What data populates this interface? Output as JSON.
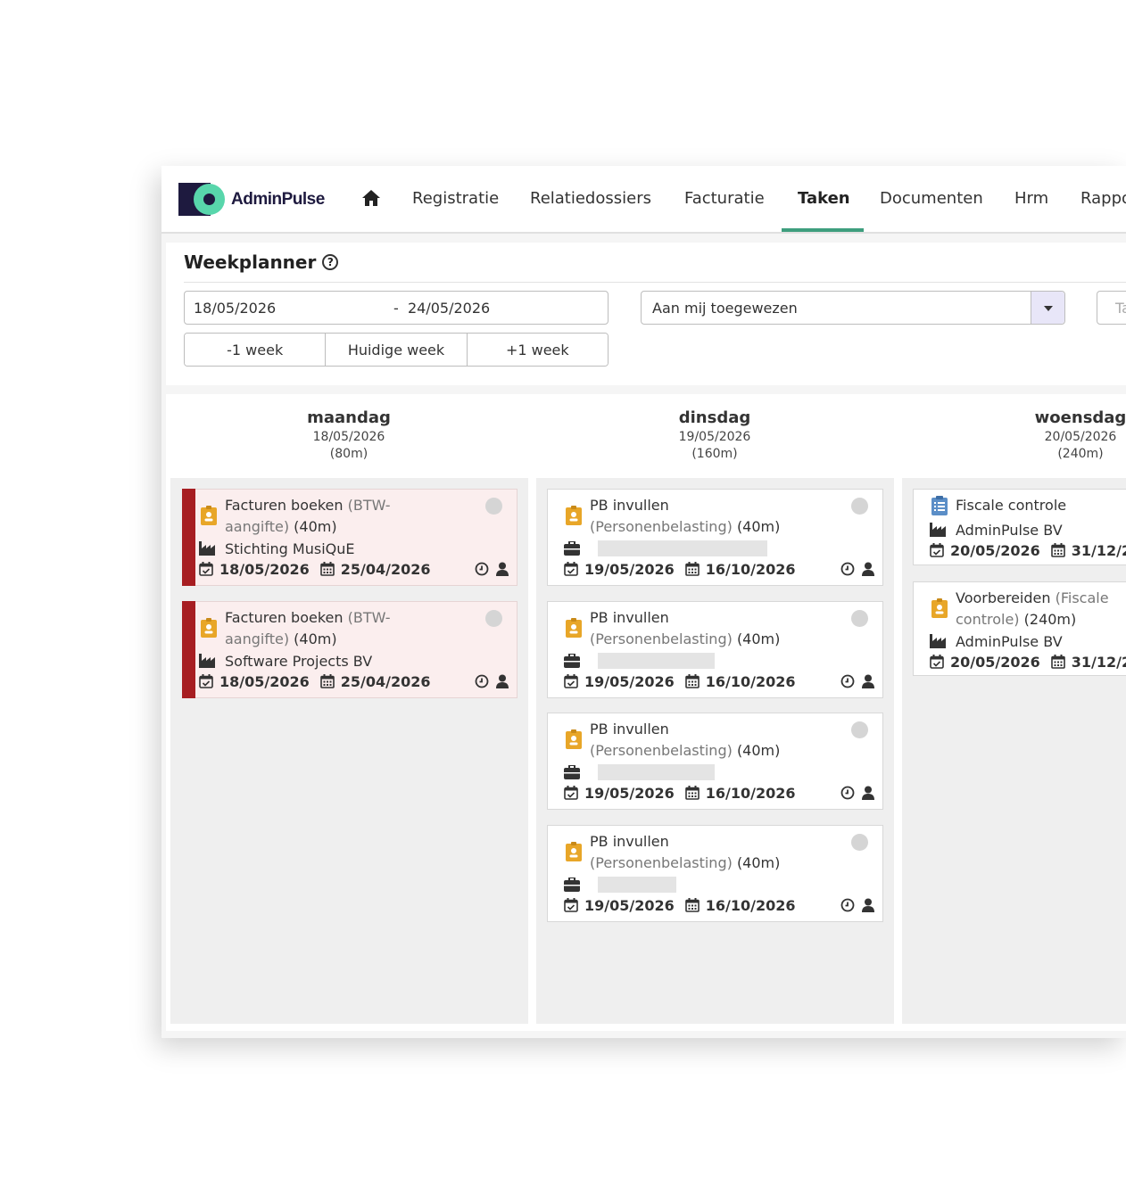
{
  "app": {
    "brand": "AdminPulse",
    "colors": {
      "brand_dark": "#1e1a3f",
      "brand_accent": "#58d6ab",
      "tab_underline": "#3e9e7e",
      "overdue": "#a71e22",
      "task_icon": "#e8a628",
      "clipboard_icon": "#5b8ec7"
    }
  },
  "nav": {
    "home_icon": "home-icon",
    "items": [
      {
        "label": "Registratie"
      },
      {
        "label": "Relatiedossiers"
      },
      {
        "label": "Facturatie"
      },
      {
        "label": "Taken",
        "active": true
      },
      {
        "label": "Documenten"
      },
      {
        "label": "Hrm"
      },
      {
        "label": "Rapportering"
      }
    ]
  },
  "planner": {
    "title": "Weekplanner",
    "help_icon": "question-circle-icon",
    "date_from": "18/05/2026",
    "date_separator": "-",
    "date_to": "24/05/2026",
    "week_buttons": [
      "-1 week",
      "Huidige week",
      "+1 week"
    ],
    "assignee_filter": "Aan mij toegewezen",
    "extra_filter_placeholder": "Taken"
  },
  "days": [
    {
      "name": "maandag",
      "date": "18/05/2026",
      "duration": "(80m)",
      "tasks": [
        {
          "type_icon": "id-badge-icon",
          "title": "Facturen boeken",
          "subtitle": "(BTW-aangifte)",
          "subtitle_line1": "(BTW-",
          "subtitle_line2": "aangifte)",
          "duration": "(40m)",
          "client_icon": "factory-icon",
          "client": "Stichting MusiQuE",
          "start": "18/05/2026",
          "due": "25/04/2026",
          "overdue": true
        },
        {
          "type_icon": "id-badge-icon",
          "title": "Facturen boeken",
          "subtitle": "(BTW-aangifte)",
          "subtitle_line1": "(BTW-",
          "subtitle_line2": "aangifte)",
          "duration": "(40m)",
          "client_icon": "factory-icon",
          "client": "Software Projects BV",
          "start": "18/05/2026",
          "due": "25/04/2026",
          "overdue": true
        }
      ]
    },
    {
      "name": "dinsdag",
      "date": "19/05/2026",
      "duration": "(160m)",
      "tasks": [
        {
          "type_icon": "id-badge-icon",
          "title": "PB invullen",
          "subtitle": "(Personenbelasting)",
          "duration": "(40m)",
          "client_icon": "briefcase-icon",
          "client": "",
          "start": "19/05/2026",
          "due": "16/10/2026",
          "overdue": false
        },
        {
          "type_icon": "id-badge-icon",
          "title": "PB invullen",
          "subtitle": "(Personenbelasting)",
          "duration": "(40m)",
          "client_icon": "briefcase-icon",
          "client": "",
          "start": "19/05/2026",
          "due": "16/10/2026",
          "overdue": false
        },
        {
          "type_icon": "id-badge-icon",
          "title": "PB invullen",
          "subtitle": "(Personenbelasting)",
          "duration": "(40m)",
          "client_icon": "briefcase-icon",
          "client": "",
          "start": "19/05/2026",
          "due": "16/10/2026",
          "overdue": false
        },
        {
          "type_icon": "id-badge-icon",
          "title": "PB invullen",
          "subtitle": "(Personenbelasting)",
          "duration": "(40m)",
          "client_icon": "briefcase-icon",
          "client": "",
          "start": "19/05/2026",
          "due": "16/10/2026",
          "overdue": false
        }
      ]
    },
    {
      "name": "woensdag",
      "date": "20/05/2026",
      "duration": "(240m)",
      "tasks": [
        {
          "type_icon": "clipboard-list-icon",
          "title": "Fiscale controle",
          "client_icon": "factory-icon",
          "client": "AdminPulse BV",
          "start": "20/05/2026",
          "due": "31/12/2"
        },
        {
          "type_icon": "id-badge-icon",
          "title": "Voorbereiden",
          "subtitle": "(Fiscale controle)",
          "subtitle_line1": "(Fiscale",
          "subtitle_line2": "controle)",
          "duration": "(240m)",
          "client_icon": "factory-icon",
          "client": "AdminPulse BV",
          "start": "20/05/2026",
          "due": "31/12/2"
        }
      ]
    }
  ]
}
